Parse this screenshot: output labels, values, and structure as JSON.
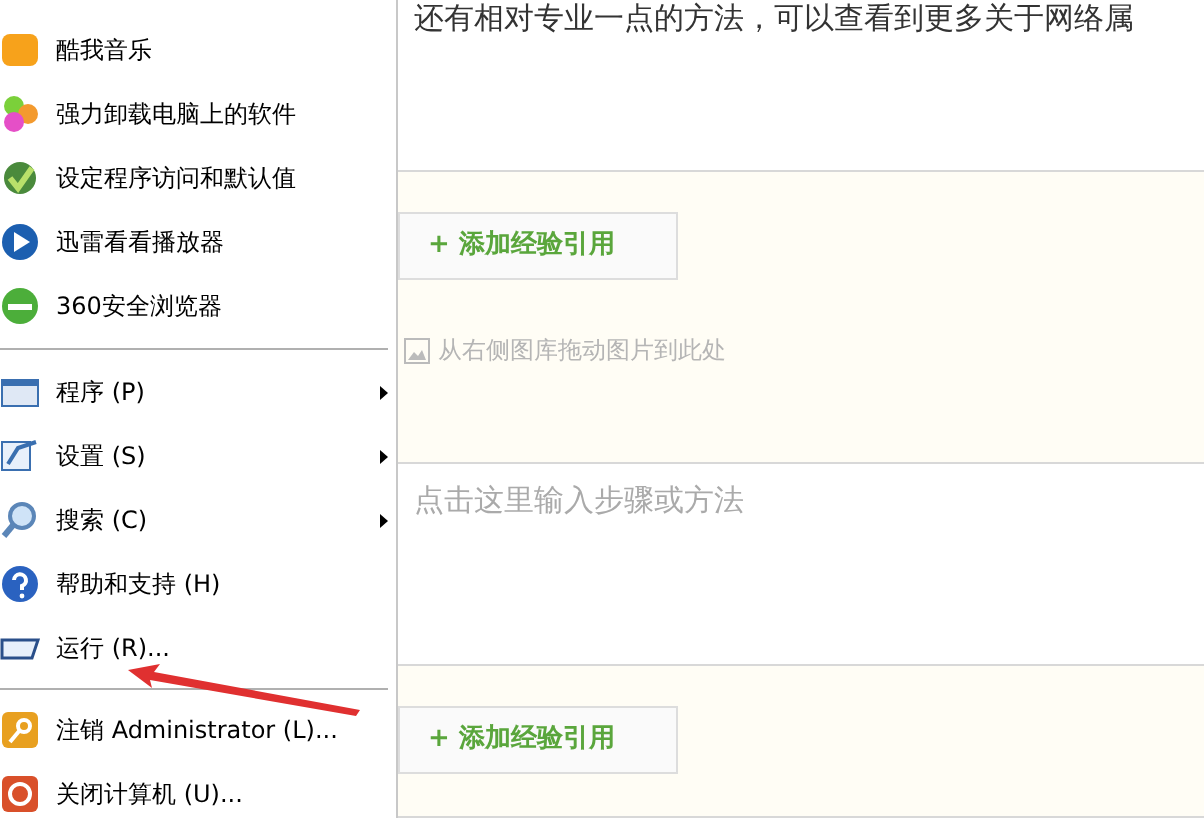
{
  "start_menu": {
    "pinned": [
      {
        "label": "酷我音乐"
      },
      {
        "label": "强力卸载电脑上的软件"
      },
      {
        "label": "设定程序访问和默认值"
      },
      {
        "label": "迅雷看看播放器"
      },
      {
        "label": "360安全浏览器"
      }
    ],
    "system": [
      {
        "label": "程序 (P)",
        "has_submenu": true
      },
      {
        "label": "设置 (S)",
        "has_submenu": true
      },
      {
        "label": "搜索 (C)",
        "has_submenu": true
      },
      {
        "label": "帮助和支持 (H)",
        "has_submenu": false
      },
      {
        "label": "运行 (R)...",
        "has_submenu": false
      }
    ],
    "session": [
      {
        "label": "注销 Administrator (L)..."
      },
      {
        "label": "关闭计算机 (U)..."
      }
    ]
  },
  "editor": {
    "intro_text": "还有相对专业一点的方法，可以查看到更多关于网络属",
    "sections": [
      {
        "kind": "citation",
        "button": "+ 添加经验引用",
        "image_hint": "从右侧图库拖动图片到此处"
      },
      {
        "kind": "step",
        "placeholder": "点击这里输入步骤或方法"
      },
      {
        "kind": "citation",
        "button": "+ 添加经验引用"
      }
    ]
  }
}
